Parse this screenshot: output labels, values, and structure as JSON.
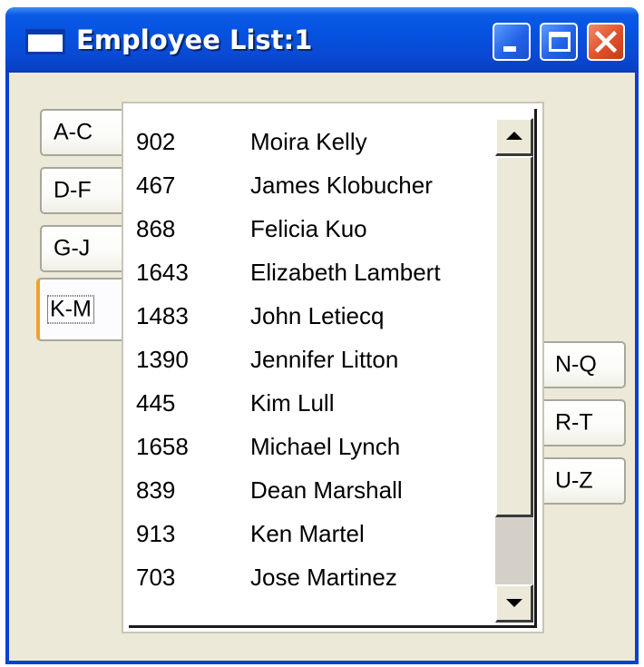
{
  "window": {
    "title": "Employee List:1",
    "controls": {
      "minimize": "minimize-icon",
      "maximize": "maximize-icon",
      "close": "close-icon"
    },
    "accent": "#0a5ae6",
    "close_color": "#e0512a"
  },
  "tabs": {
    "left": [
      "A-C",
      "D-F",
      "G-J",
      "K-M"
    ],
    "right": [
      "N-Q",
      "R-T",
      "U-Z"
    ],
    "selected": "K-M"
  },
  "employees": [
    {
      "id": "902",
      "name": "Moira Kelly"
    },
    {
      "id": "467",
      "name": "James Klobucher"
    },
    {
      "id": "868",
      "name": "Felicia Kuo"
    },
    {
      "id": "1643",
      "name": "Elizabeth Lambert"
    },
    {
      "id": "1483",
      "name": "John Letiecq"
    },
    {
      "id": "1390",
      "name": "Jennifer Litton"
    },
    {
      "id": "445",
      "name": "Kim Lull"
    },
    {
      "id": "1658",
      "name": "Michael Lynch"
    },
    {
      "id": "839",
      "name": "Dean Marshall"
    },
    {
      "id": "913",
      "name": "Ken Martel"
    },
    {
      "id": "703",
      "name": "Jose Martinez"
    }
  ]
}
